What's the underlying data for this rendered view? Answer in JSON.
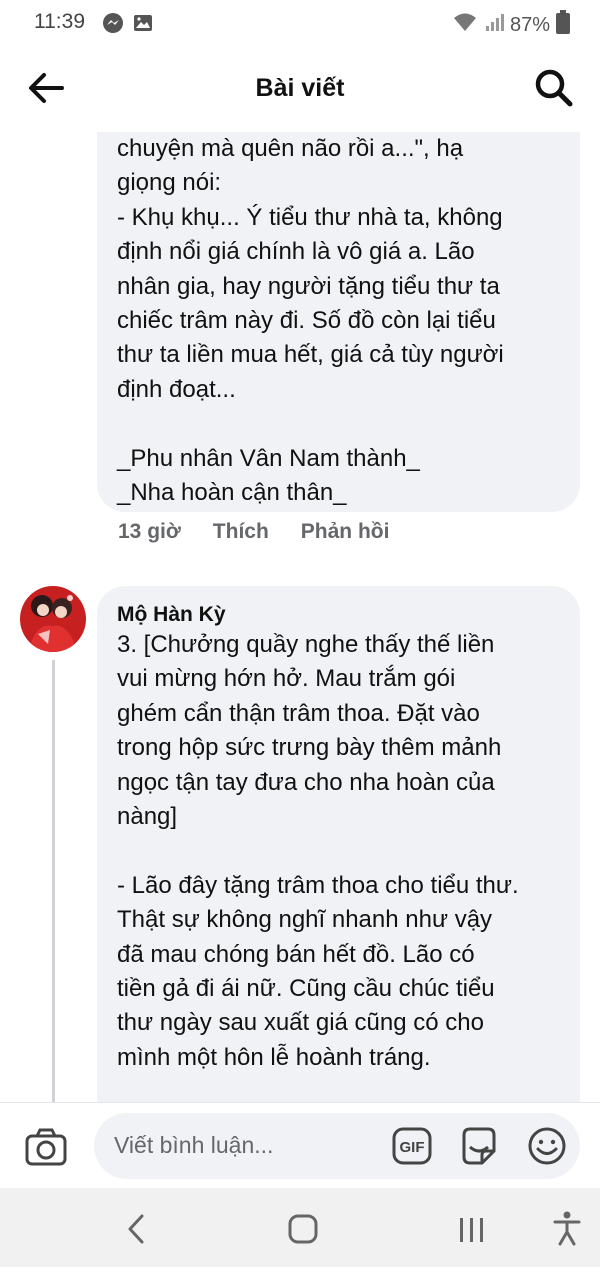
{
  "status": {
    "time": "11:39",
    "battery": "87%",
    "icons": [
      "messenger-icon",
      "image-icon",
      "wifi-icon",
      "signal-icon",
      "battery-icon"
    ]
  },
  "header": {
    "title": "Bài viết",
    "back_icon": "arrow-left-icon",
    "search_icon": "search-icon"
  },
  "comment1": {
    "text": "chuyện mà quên não rồi a...\", hạ\ngiọng nói:\n- Khụ khụ... Ý tiểu thư nhà ta, không\nđịnh nổi giá chính là vô giá a. Lão\nnhân gia, hay người tặng tiểu thư ta\nchiếc trâm này đi. Số đồ còn lại tiểu\nthư ta liền mua hết, giá cả tùy người\nđịnh đoạt...\n\n_Phu nhân Vân Nam thành_\n_Nha hoàn cận thân_",
    "time": "13 giờ",
    "like": "Thích",
    "reply": "Phản hồi"
  },
  "comment2": {
    "author": "Mộ Hàn Kỳ",
    "text": "3. [Chưởng quầy nghe thấy thế liền\nvui mừng hớn hở. Mau trắm gói\nghém cẩn thận trâm thoa. Đặt vào\ntrong hộp sức trưng bày thêm mảnh\nngọc tận tay đưa cho nha hoàn của\nnàng]\n\n- Lão đây tặng trâm thoa cho tiểu thư.\nThật sự không nghĩ nhanh như vậy\nđã mau chóng bán hết đồ. Lão có\ntiền gả đi ái nữ. Cũng cầu chúc tiểu\nthư ngày sau xuất giá cũng có cho\nmình một hôn lễ hoành tráng."
  },
  "composer": {
    "placeholder": "Viết bình luận...",
    "gif_label": "GIF"
  },
  "colors": {
    "bubble": "#f0f2f5",
    "secondary_text": "#65676b",
    "navbar": "#f1f1f1"
  }
}
